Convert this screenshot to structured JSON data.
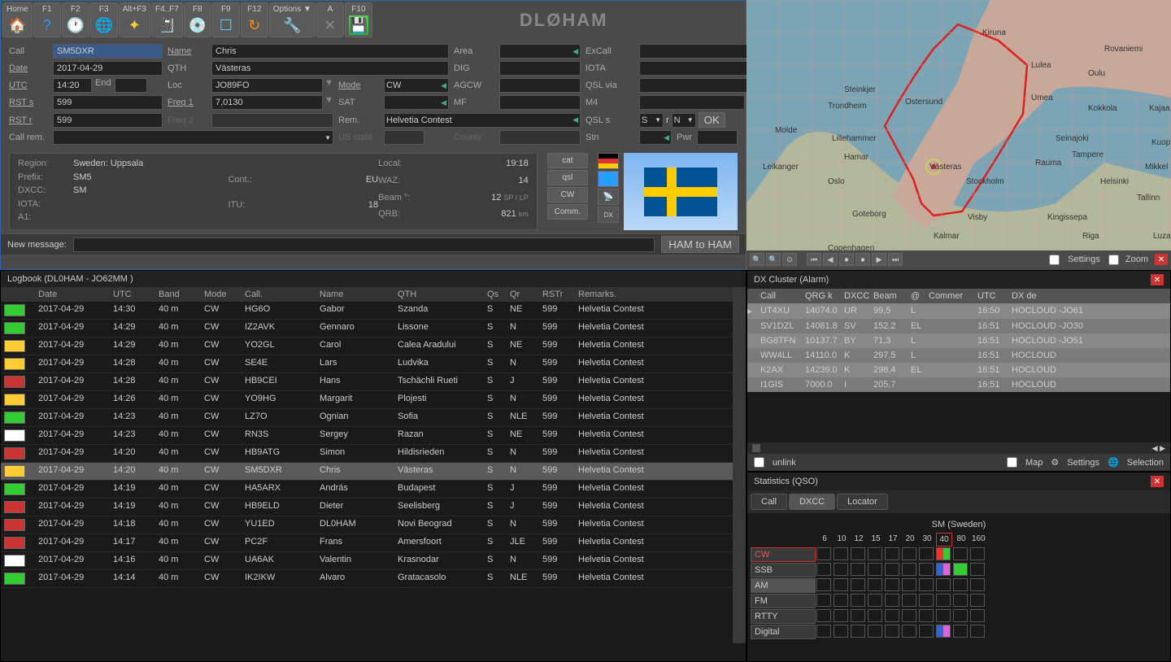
{
  "app_title": "DLØHAM",
  "toolbar": {
    "buttons": [
      {
        "label": "Home",
        "icon": "🏠",
        "color": "#f80"
      },
      {
        "label": "F1",
        "icon": "?",
        "color": "#39f"
      },
      {
        "label": "F2",
        "icon": "🕐",
        "color": "#ccc"
      },
      {
        "label": "F3",
        "icon": "🌐",
        "color": "#3c6"
      },
      {
        "label": "Alt+F3",
        "icon": "✦",
        "color": "#fc3"
      },
      {
        "label": "F4..F7",
        "icon": "📓",
        "color": "#c83"
      },
      {
        "label": "F8",
        "icon": "💿",
        "color": "#aaa"
      },
      {
        "label": "F9",
        "icon": "☐",
        "color": "#5cf"
      },
      {
        "label": "F12",
        "icon": "↻",
        "color": "#f80"
      },
      {
        "label": "Options ▼",
        "icon": "🔧",
        "color": "#ccc"
      },
      {
        "label": "A",
        "icon": "✕",
        "color": "#888"
      },
      {
        "label": "F10",
        "icon": "💾",
        "color": "#3c3"
      }
    ]
  },
  "form": {
    "call_label": "Call",
    "call": "SM5DXR",
    "name_label": "Name",
    "name": "Chris",
    "area_label": "Area",
    "area": "",
    "excall_label": "ExCall",
    "excall": "",
    "date_label": "Date",
    "date": "2017-04-29",
    "qth_label": "QTH",
    "qth": "Västeras",
    "dig_label": "DIG",
    "dig": "",
    "iota_label": "IOTA",
    "iota": "",
    "utc_label": "UTC",
    "utc": "14:20",
    "end_label": "End",
    "end": "",
    "loc_label": "Loc",
    "loc": "JO89FO",
    "mode_label": "Mode",
    "mode": "CW",
    "agcw_label": "AGCW",
    "qslvia_label": "QSL via",
    "rsts_label": "RST s",
    "rsts": "599",
    "freq1_label": "Freq 1",
    "freq1": "7,0130",
    "sat_label": "SAT",
    "mf_label": "MF",
    "m4_label": "M4",
    "rstr_label": "RST r",
    "rstr": "599",
    "freq2_label": "Freq 2",
    "rem_label": "Rem.",
    "rem": "Helvetia Contest",
    "qsls_label": "QSL s",
    "qsls": "S",
    "r_label": "r",
    "r": "N",
    "ok": "OK",
    "callrem_label": "Call rem.",
    "usstate_label": "US state",
    "county_label": "County",
    "stn_label": "Stn",
    "pwr_label": "Pwr"
  },
  "info": {
    "region_label": "Region:",
    "region": "Sweden: Uppsala",
    "prefix_label": "Prefix:",
    "prefix": "SM5",
    "dxcc_label": "DXCC:",
    "dxcc": "SM",
    "iota_label": "IOTA:",
    "a1_label": "A1:",
    "cont_label": "Cont.:",
    "cont": "EU",
    "itu_label": "ITU:",
    "itu": "18",
    "local_label": "Local:",
    "local": "19:18",
    "waz_label": "WAZ:",
    "waz": "14",
    "beam_label": "Beam °:",
    "beam": "12",
    "beam_sfx": "SP / LP",
    "qrb_label": "QRB:",
    "qrb": "821",
    "qrb_sfx": "km"
  },
  "side_buttons": [
    "cat",
    "qsl",
    "CW",
    "Comm."
  ],
  "msg": {
    "label": "New message:",
    "ham": "HAM to HAM"
  },
  "map": {
    "cities": [
      "Kiruna",
      "Rovaniemi",
      "Lulea",
      "Oulu",
      "Ostersund",
      "Umea",
      "Kokkola",
      "Kajaa",
      "Steinkjer",
      "Trondheim",
      "Molde",
      "Lillehammer",
      "Seinajoki",
      "Kuop",
      "Tampere",
      "Mikkel",
      "Hamar",
      "Rauma",
      "Leikanger",
      "Västeras",
      "Oslo",
      "Stockholm",
      "Helsinki",
      "Tallinn",
      "Goteborg",
      "Visby",
      "Kingissepa",
      "Riga",
      "Kalmar",
      "Luza",
      "Copenhagen"
    ],
    "settings": "Settings",
    "zoom": "Zoom"
  },
  "logbook": {
    "title": "Logbook  (DL0HAM - JO62MM )",
    "headers": {
      "date": "Date",
      "utc": "UTC",
      "band": "Band",
      "mode": "Mode",
      "call": "Call.",
      "name": "Name",
      "qth": "QTH",
      "qs": "Qs",
      "qr": "Qr",
      "rstr": "RSTr",
      "rem": "Remarks."
    },
    "rows": [
      {
        "date": "2017-04-29",
        "utc": "14:30",
        "band": "40 m",
        "mode": "CW",
        "call": "HG6O",
        "name": "Gabor",
        "qth": "Szanda",
        "qs": "S",
        "qr": "NE",
        "rstr": "599",
        "rem": "Helvetia Contest",
        "fc": "#3c3"
      },
      {
        "date": "2017-04-29",
        "utc": "14:29",
        "band": "40 m",
        "mode": "CW",
        "call": "IZ2AVK",
        "name": "Gennaro",
        "qth": "Lissone",
        "qs": "S",
        "qr": "N",
        "rstr": "599",
        "rem": "Helvetia Contest",
        "fc": "#3c3"
      },
      {
        "date": "2017-04-29",
        "utc": "14:29",
        "band": "40 m",
        "mode": "CW",
        "call": "YO2GL",
        "name": "Carol",
        "qth": "Calea Aradului",
        "qs": "S",
        "qr": "NE",
        "rstr": "599",
        "rem": "Helvetia Contest",
        "fc": "#fc3"
      },
      {
        "date": "2017-04-29",
        "utc": "14:28",
        "band": "40 m",
        "mode": "CW",
        "call": "SE4E",
        "name": "Lars",
        "qth": "Ludvika",
        "qs": "S",
        "qr": "N",
        "rstr": "599",
        "rem": "Helvetia Contest",
        "fc": "#fc3"
      },
      {
        "date": "2017-04-29",
        "utc": "14:28",
        "band": "40 m",
        "mode": "CW",
        "call": "HB9CEI",
        "name": "Hans",
        "qth": "Tschächli Rueti",
        "qs": "S",
        "qr": "J",
        "rstr": "599",
        "rem": "Helvetia Contest",
        "fc": "#c33"
      },
      {
        "date": "2017-04-29",
        "utc": "14:26",
        "band": "40 m",
        "mode": "CW",
        "call": "YO9HG",
        "name": "Margarit",
        "qth": "Plojesti",
        "qs": "S",
        "qr": "N",
        "rstr": "599",
        "rem": "Helvetia Contest",
        "fc": "#fc3"
      },
      {
        "date": "2017-04-29",
        "utc": "14:23",
        "band": "40 m",
        "mode": "CW",
        "call": "LZ7O",
        "name": "Ognian",
        "qth": "Sofia",
        "qs": "S",
        "qr": "NLE",
        "rstr": "599",
        "rem": "Helvetia Contest",
        "fc": "#3c3"
      },
      {
        "date": "2017-04-29",
        "utc": "14:23",
        "band": "40 m",
        "mode": "CW",
        "call": "RN3S",
        "name": "Sergey",
        "qth": "Razan",
        "qs": "S",
        "qr": "NE",
        "rstr": "599",
        "rem": "Helvetia Contest",
        "fc": "#fff"
      },
      {
        "date": "2017-04-29",
        "utc": "14:20",
        "band": "40 m",
        "mode": "CW",
        "call": "HB9ATG",
        "name": "Simon",
        "qth": "Hildisrieden",
        "qs": "S",
        "qr": "N",
        "rstr": "599",
        "rem": "Helvetia Contest",
        "fc": "#c33"
      },
      {
        "date": "2017-04-29",
        "utc": "14:20",
        "band": "40 m",
        "mode": "CW",
        "call": "SM5DXR",
        "name": "Chris",
        "qth": "Västeras",
        "qs": "S",
        "qr": "N",
        "rstr": "599",
        "rem": "Helvetia Contest",
        "fc": "#fc3",
        "sel": true
      },
      {
        "date": "2017-04-29",
        "utc": "14:19",
        "band": "40 m",
        "mode": "CW",
        "call": "HA5ARX",
        "name": "András",
        "qth": "Budapest",
        "qs": "S",
        "qr": "J",
        "rstr": "599",
        "rem": "Helvetia Contest",
        "fc": "#3c3"
      },
      {
        "date": "2017-04-29",
        "utc": "14:19",
        "band": "40 m",
        "mode": "CW",
        "call": "HB9ELD",
        "name": "Dieter",
        "qth": "Seelisberg",
        "qs": "S",
        "qr": "J",
        "rstr": "599",
        "rem": "Helvetia Contest",
        "fc": "#c33"
      },
      {
        "date": "2017-04-29",
        "utc": "14:18",
        "band": "40 m",
        "mode": "CW",
        "call": "YU1ED",
        "name": "DL0HAM",
        "qth": "Novi Beograd",
        "qs": "S",
        "qr": "N",
        "rstr": "599",
        "rem": "Helvetia Contest",
        "fc": "#c33"
      },
      {
        "date": "2017-04-29",
        "utc": "14:17",
        "band": "40 m",
        "mode": "CW",
        "call": "PC2F",
        "name": "Frans",
        "qth": "Amersfoort",
        "qs": "S",
        "qr": "JLE",
        "rstr": "599",
        "rem": "Helvetia Contest",
        "fc": "#c33"
      },
      {
        "date": "2017-04-29",
        "utc": "14:16",
        "band": "40 m",
        "mode": "CW",
        "call": "UA6AK",
        "name": "Valentin",
        "qth": "Krasnodar",
        "qs": "S",
        "qr": "N",
        "rstr": "599",
        "rem": "Helvetia Contest",
        "fc": "#fff"
      },
      {
        "date": "2017-04-29",
        "utc": "14:14",
        "band": "40 m",
        "mode": "CW",
        "call": "IK2IKW",
        "name": "Alvaro",
        "qth": "Gratacasolo",
        "qs": "S",
        "qr": "NLE",
        "rstr": "599",
        "rem": "Helvetia Contest",
        "fc": "#3c3"
      }
    ]
  },
  "dxcluster": {
    "title": "DX Cluster (Alarm)",
    "headers": {
      "call": "Call",
      "qrg": "QRG k",
      "dxcc": "DXCC",
      "beam": "Beam",
      "at": "@",
      "com": "Commer",
      "utc": "UTC",
      "dxde": "DX de"
    },
    "rows": [
      {
        "call": "UT4XU",
        "qrg": "14074.0",
        "dxcc": "UR",
        "beam": "99,5",
        "at": "L",
        "com": "",
        "utc": "16:50",
        "dxde": "HOCLOUD -JO61"
      },
      {
        "call": "SV1DZL",
        "qrg": "14081.8",
        "dxcc": "SV",
        "beam": "152,2",
        "at": "EL",
        "com": "",
        "utc": "16:51",
        "dxde": "HOCLOUD -JO30"
      },
      {
        "call": "BG8TFN",
        "qrg": "10137.7",
        "dxcc": "BY",
        "beam": "71,3",
        "at": "L",
        "com": "",
        "utc": "16:51",
        "dxde": "HOCLOUD -JO51"
      },
      {
        "call": "WW4LL",
        "qrg": "14110.0",
        "dxcc": "K",
        "beam": "297,5",
        "at": "L",
        "com": "",
        "utc": "16:51",
        "dxde": "HOCLOUD"
      },
      {
        "call": "K2AX",
        "qrg": "14239.0",
        "dxcc": "K",
        "beam": "298,4",
        "at": "EL",
        "com": "",
        "utc": "16:51",
        "dxde": "HOCLOUD"
      },
      {
        "call": "I1GIS",
        "qrg": "7000.0",
        "dxcc": "I",
        "beam": "205,7",
        "at": "",
        "com": "",
        "utc": "16:51",
        "dxde": "HOCLOUD"
      }
    ],
    "unlink": "unlink",
    "map": "Map",
    "settings": "Settings",
    "selection": "Selection"
  },
  "stats": {
    "title": "Statistics (QSO)",
    "tabs": [
      "Call",
      "DXCC",
      "Locator"
    ],
    "active_tab": 1,
    "dx_title": "SM (Sweden)",
    "bands": [
      "6",
      "10",
      "12",
      "15",
      "17",
      "20",
      "30",
      "40",
      "80",
      "160"
    ],
    "modes": [
      "CW",
      "SSB",
      "AM",
      "FM",
      "RTTY",
      "Digital"
    ]
  }
}
